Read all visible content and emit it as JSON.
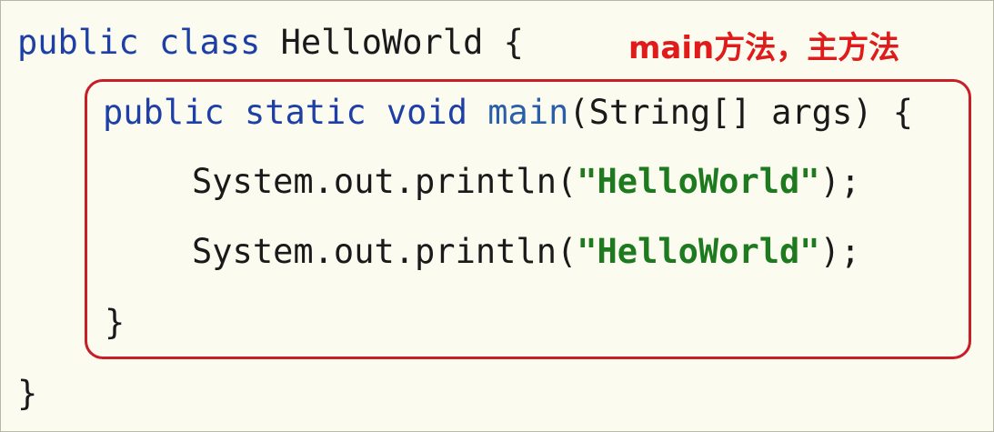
{
  "annotation": {
    "text": "main方法，主方法",
    "color": "#e01b1b"
  },
  "code": {
    "line1": {
      "kw_public": "public",
      "kw_class": "class",
      "class_name": "HelloWorld",
      "open_brace": "{"
    },
    "line2": {
      "kw_public": "public",
      "kw_static": "static",
      "kw_void": "void",
      "method_name": "main",
      "params": "(String[] args)",
      "open_brace": "{"
    },
    "line3": {
      "call": "System.out.println(",
      "string": "\"HelloWorld\"",
      "end": ");"
    },
    "line4": {
      "call": "System.out.println(",
      "string": "\"HelloWorld\"",
      "end": ");"
    },
    "line5": {
      "close_brace": "}"
    },
    "line6": {
      "close_brace": "}"
    }
  },
  "colors": {
    "keyword": "#1e3fa6",
    "method": "#2a5fa8",
    "string": "#1e7a1e",
    "highlight_border": "#c81e28",
    "background": "#fbfbf0"
  }
}
